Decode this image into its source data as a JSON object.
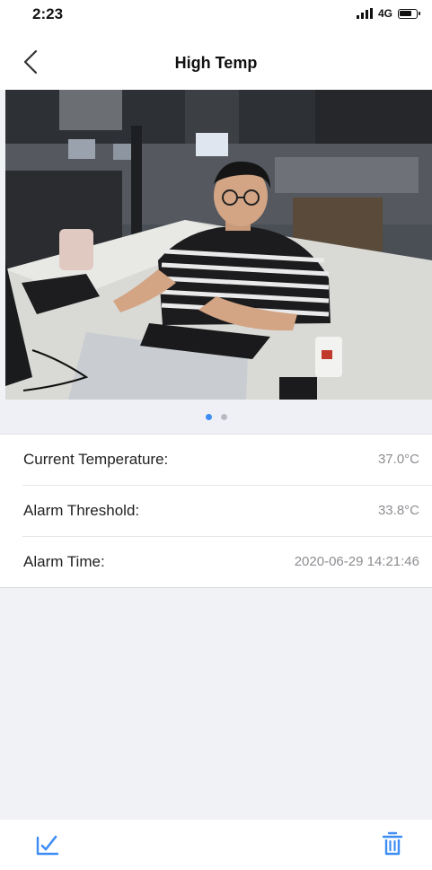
{
  "status": {
    "time": "2:23",
    "network": "4G"
  },
  "header": {
    "title": "High Temp"
  },
  "carousel": {
    "page_count": 2,
    "active_index": 0
  },
  "details": [
    {
      "label": "Current Temperature:",
      "value": "37.0°C"
    },
    {
      "label": "Alarm Threshold:",
      "value": "33.8°C"
    },
    {
      "label": "Alarm Time:",
      "value": "2020-06-29 14:21:46"
    }
  ],
  "toolbar": {
    "left_icon": "checkmark-edit-icon",
    "right_icon": "trash-icon"
  },
  "colors": {
    "accent": "#3d8df5",
    "page_bg": "#f1f2f6"
  }
}
